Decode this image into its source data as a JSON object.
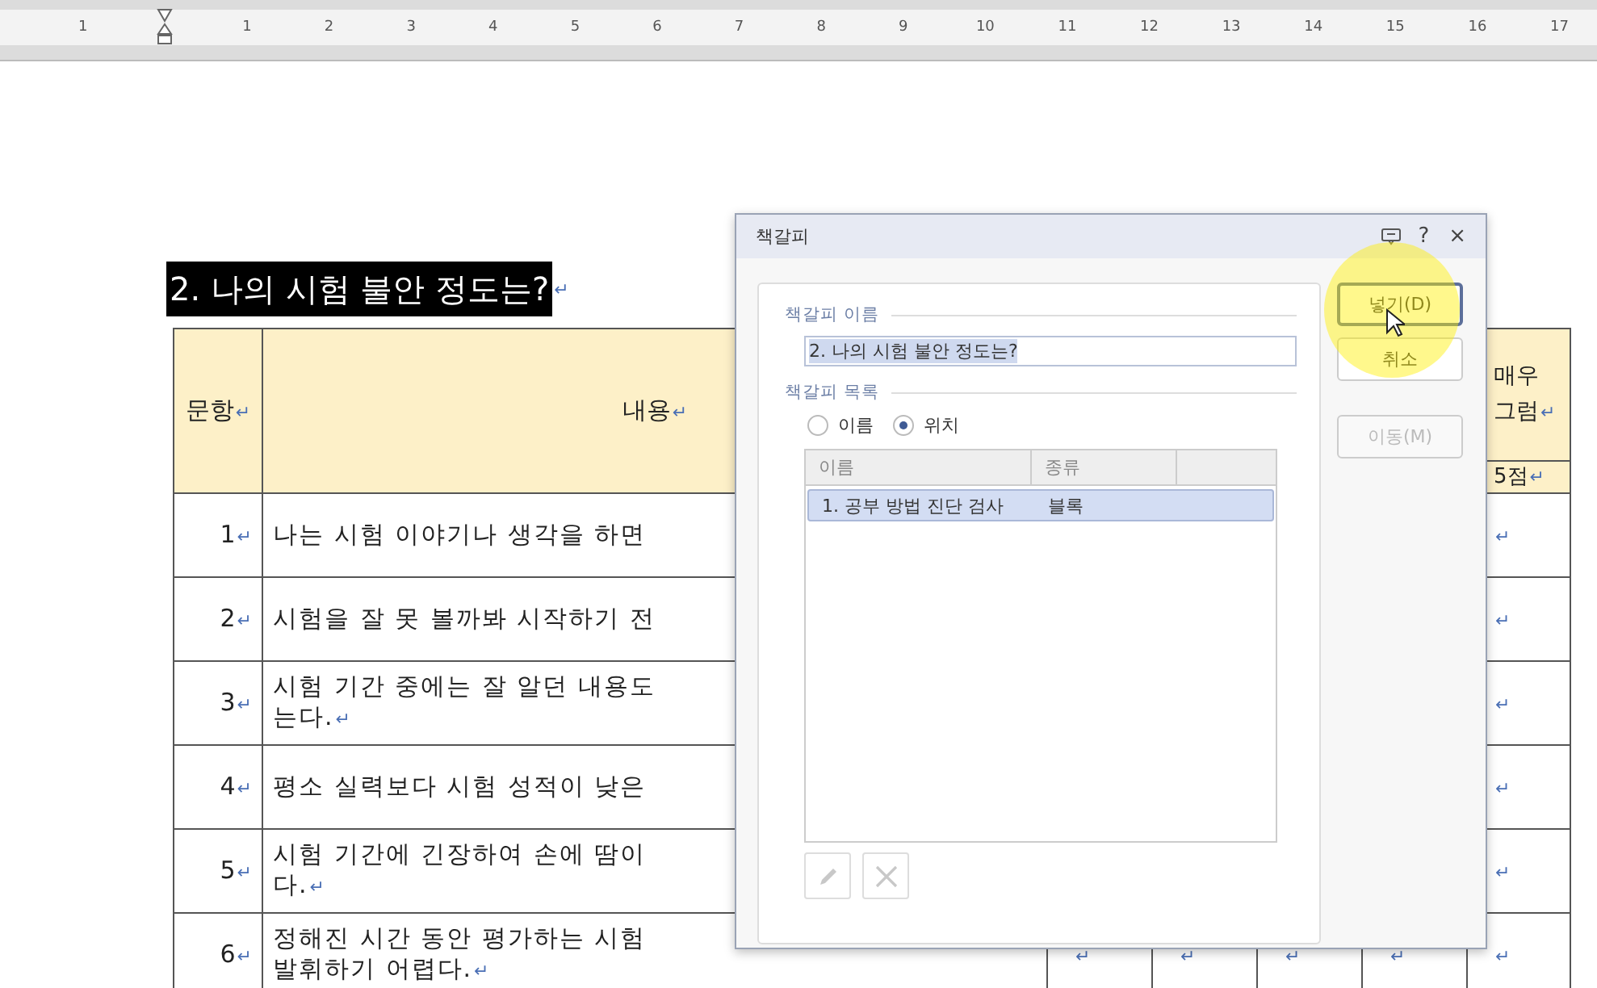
{
  "ruler": {
    "labels": [
      "1",
      "1",
      "2",
      "3",
      "4",
      "5",
      "6",
      "7",
      "8",
      "9",
      "10",
      "11",
      "12",
      "13",
      "14",
      "15",
      "16",
      "17"
    ]
  },
  "heading": {
    "text": "2. 나의 시험 불안 정도는?",
    "mark": "↵"
  },
  "table": {
    "header": {
      "item": {
        "text": "문항",
        "mark": "↵"
      },
      "content": {
        "text": "내용",
        "mark": "↵"
      },
      "last_score": {
        "text": "매우\n그럼",
        "mark": "↵"
      },
      "last_points": {
        "text": "5점",
        "mark": "↵"
      }
    },
    "rows": [
      {
        "item": {
          "text": "1",
          "mark": "↵"
        },
        "content": {
          "text": "나는 시험 이야기나 생각을 하면"
        },
        "scores": [
          "↵"
        ]
      },
      {
        "item": {
          "text": "2",
          "mark": "↵"
        },
        "content": {
          "text": "시험을 잘 못 볼까봐 시작하기 전"
        },
        "scores": [
          "↵"
        ]
      },
      {
        "item": {
          "text": "3",
          "mark": "↵"
        },
        "content": {
          "text": "시험 기간 중에는 잘 알던 내용도\n는다.",
          "mark": "↵"
        },
        "scores": [
          "↵"
        ]
      },
      {
        "item": {
          "text": "4",
          "mark": "↵"
        },
        "content": {
          "text": "평소 실력보다 시험 성적이 낮은"
        },
        "scores": [
          "↵"
        ]
      },
      {
        "item": {
          "text": "5",
          "mark": "↵"
        },
        "content": {
          "text": "시험 기간에 긴장하여 손에 땀이\n다.",
          "mark": "↵"
        },
        "scores": [
          "↵"
        ]
      },
      {
        "item": {
          "text": "6",
          "mark": "↵"
        },
        "content": {
          "text": "정해진 시간 동안 평가하는 시험\n발휘하기 어렵다.",
          "mark": "↵"
        },
        "scores": [
          "↵",
          "↵",
          "↵",
          "↵",
          "↵"
        ]
      }
    ]
  },
  "dialog": {
    "title": "책갈피",
    "title_buttons": [
      "?",
      "×"
    ],
    "name_section": "책갈피 이름",
    "name_value": "2. 나의 시험 불안 정도는?",
    "list_section": "책갈피 목록",
    "sort_options": [
      {
        "label": "이름",
        "selected": false
      },
      {
        "label": "위치",
        "selected": true
      }
    ],
    "list": {
      "columns": [
        "이름",
        "종류"
      ],
      "rows": [
        {
          "name": "1. 공부 방법 진단 검사",
          "type": "블록",
          "selected": true
        }
      ]
    },
    "list_tools": [
      {
        "kind": "edit",
        "disabled": true
      },
      {
        "kind": "delete",
        "disabled": true
      }
    ],
    "buttons": [
      {
        "label": "넣기(D)",
        "focused": true,
        "disabled": false
      },
      {
        "label": "취소",
        "focused": false,
        "disabled": false
      },
      {
        "label": "이동(M)",
        "focused": false,
        "disabled": true
      }
    ]
  }
}
